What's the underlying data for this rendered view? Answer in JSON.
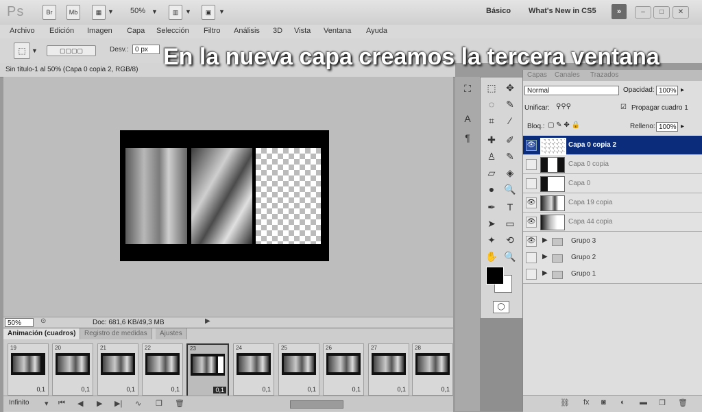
{
  "app": {
    "logo": "Ps",
    "zoom": "50%",
    "bridge": "Br",
    "minibridge": "Mb"
  },
  "workspace": {
    "basic": "Básico",
    "whats_new": "What's New in CS5",
    "switch_icon": "»"
  },
  "menu": [
    "Archivo",
    "Edición",
    "Imagen",
    "Capa",
    "Selección",
    "Filtro",
    "Análisis",
    "3D",
    "Vista",
    "Ventana",
    "Ayuda"
  ],
  "options": {
    "feather_label": "Desv.:",
    "feather_value": "0 px"
  },
  "document": {
    "tab_title": "Sin título-1 al 50% (Capa 0 copia 2, RGB/8)"
  },
  "caption": "En la nueva capa creamos la tercera ventana",
  "status": {
    "zoom": "50%",
    "doc": "Doc: 681,6 KB/49,3 MB"
  },
  "animation": {
    "tabs": [
      "Animación (cuadros)",
      "Registro de medidas",
      "Ajustes"
    ],
    "frames": [
      {
        "num": "19",
        "delay": "0,1"
      },
      {
        "num": "20",
        "delay": "0,1"
      },
      {
        "num": "21",
        "delay": "0,1"
      },
      {
        "num": "22",
        "delay": "0,1"
      },
      {
        "num": "23",
        "delay": "0,1"
      },
      {
        "num": "24",
        "delay": "0,1"
      },
      {
        "num": "25",
        "delay": "0,1"
      },
      {
        "num": "26",
        "delay": "0,1"
      },
      {
        "num": "27",
        "delay": "0,1"
      },
      {
        "num": "28",
        "delay": "0,1"
      }
    ],
    "loop": "Infinito"
  },
  "layers": {
    "tabs": [
      "Capas",
      "Canales",
      "Trazados"
    ],
    "blend_mode": "Normal",
    "opacity_label": "Opacidad:",
    "opacity": "100%",
    "unify_label": "Unificar:",
    "propagate_label": "Propagar cuadro 1",
    "lock_label": "Bloq.:",
    "fill_label": "Relleno:",
    "fill": "100%",
    "items": [
      {
        "name": "Capa 0 copia 2",
        "visible": true,
        "selected": true
      },
      {
        "name": "Capa 0 copia",
        "visible": false
      },
      {
        "name": "Capa 0",
        "visible": false
      },
      {
        "name": "Capa 19 copia",
        "visible": true
      },
      {
        "name": "Capa 44 copia",
        "visible": true
      }
    ],
    "groups": [
      {
        "name": "Grupo 3",
        "visible": true
      },
      {
        "name": "Grupo 2",
        "visible": false
      },
      {
        "name": "Grupo 1",
        "visible": false
      }
    ]
  }
}
